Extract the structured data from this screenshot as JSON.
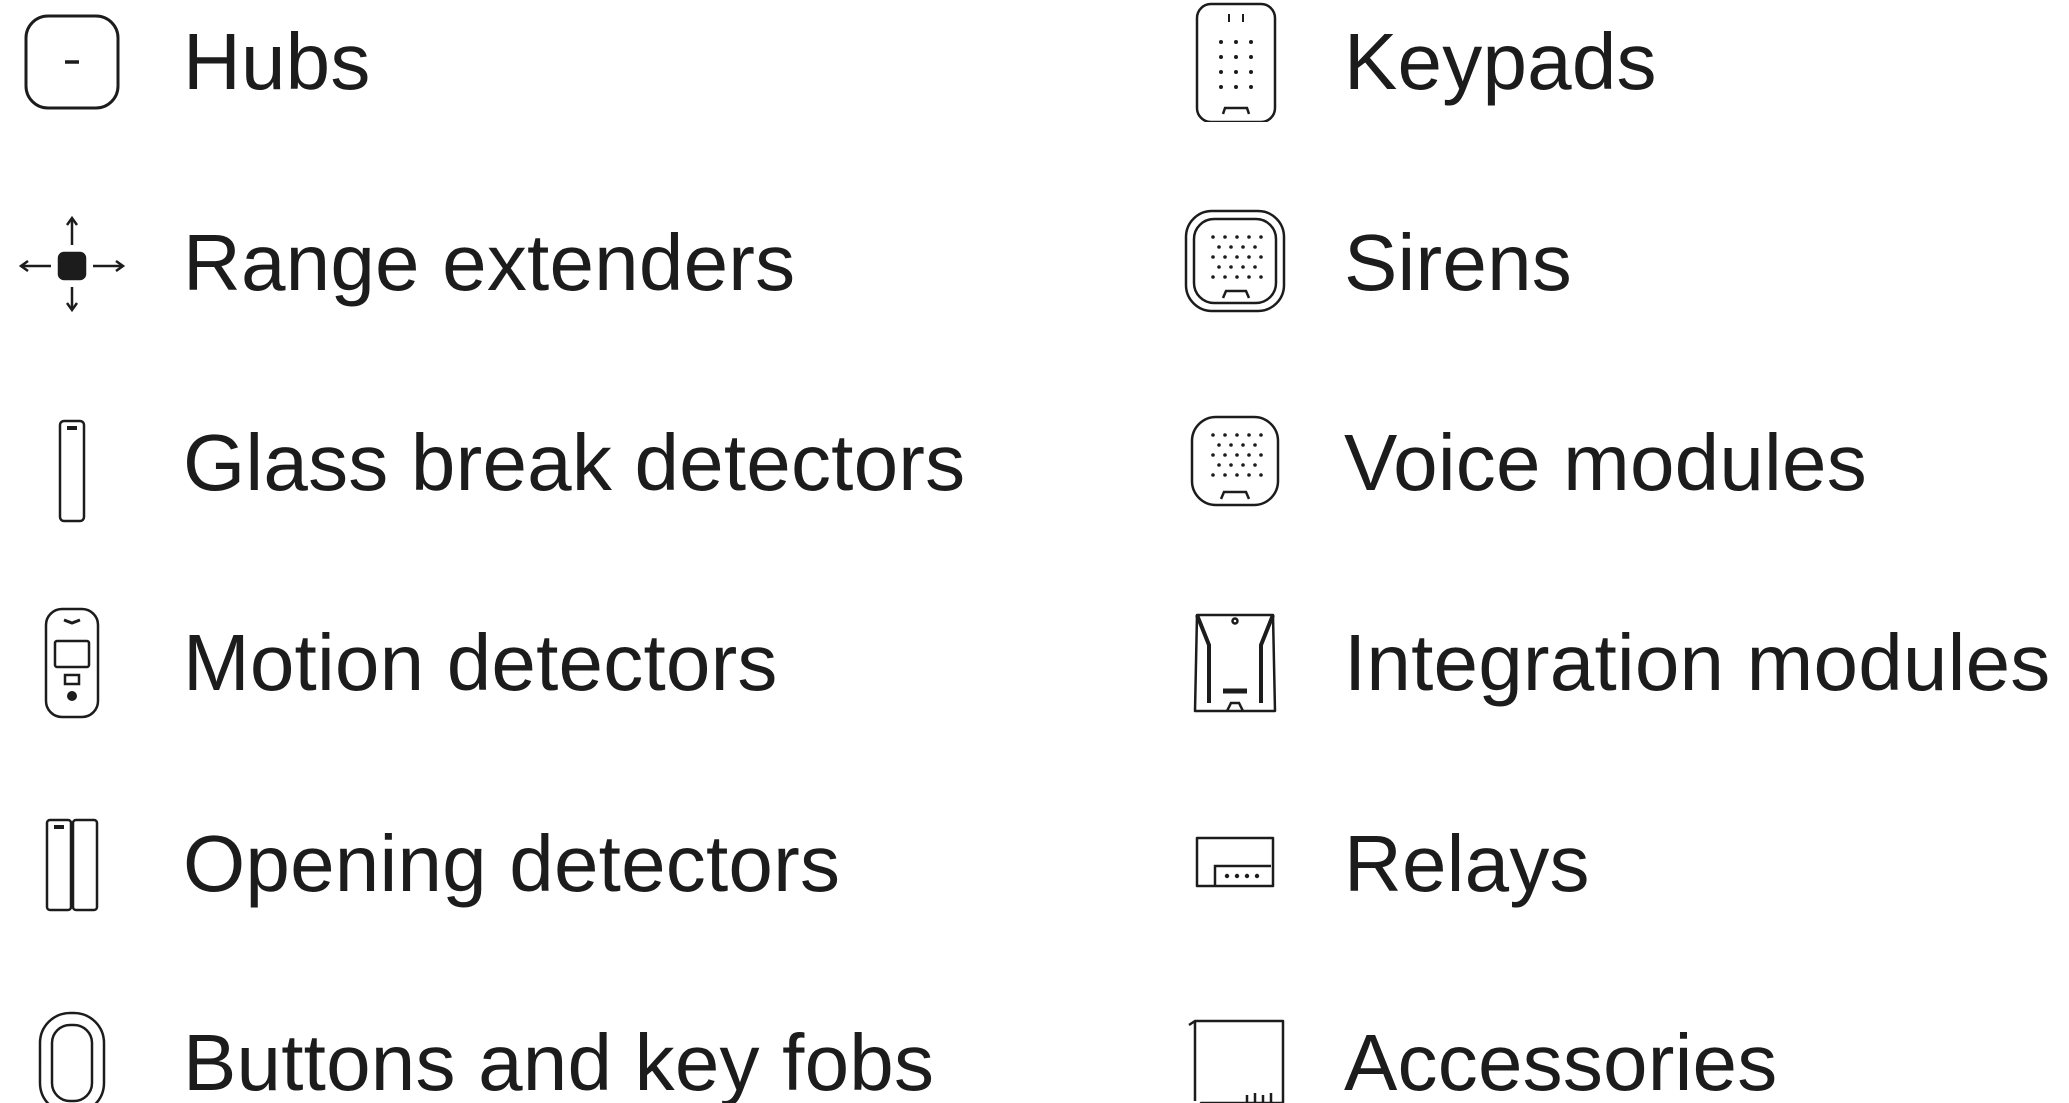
{
  "categories": {
    "left": [
      {
        "label": "Hubs",
        "icon": "hub-icon"
      },
      {
        "label": "Range extenders",
        "icon": "range-extender-icon"
      },
      {
        "label": "Glass break detectors",
        "icon": "glass-break-detector-icon"
      },
      {
        "label": "Motion detectors",
        "icon": "motion-detector-icon"
      },
      {
        "label": "Opening detectors",
        "icon": "opening-detector-icon"
      },
      {
        "label": "Buttons and key fobs",
        "icon": "button-keyfob-icon"
      }
    ],
    "right": [
      {
        "label": "Keypads",
        "icon": "keypad-icon"
      },
      {
        "label": "Sirens",
        "icon": "siren-icon"
      },
      {
        "label": "Voice modules",
        "icon": "voice-module-icon"
      },
      {
        "label": "Integration modules",
        "icon": "integration-module-icon"
      },
      {
        "label": "Relays",
        "icon": "relay-icon"
      },
      {
        "label": "Accessories",
        "icon": "accessories-icon"
      }
    ]
  },
  "colors": {
    "text": "#1c1c1c",
    "icon_stroke": "#1c1c1c",
    "background": "#ffffff"
  }
}
